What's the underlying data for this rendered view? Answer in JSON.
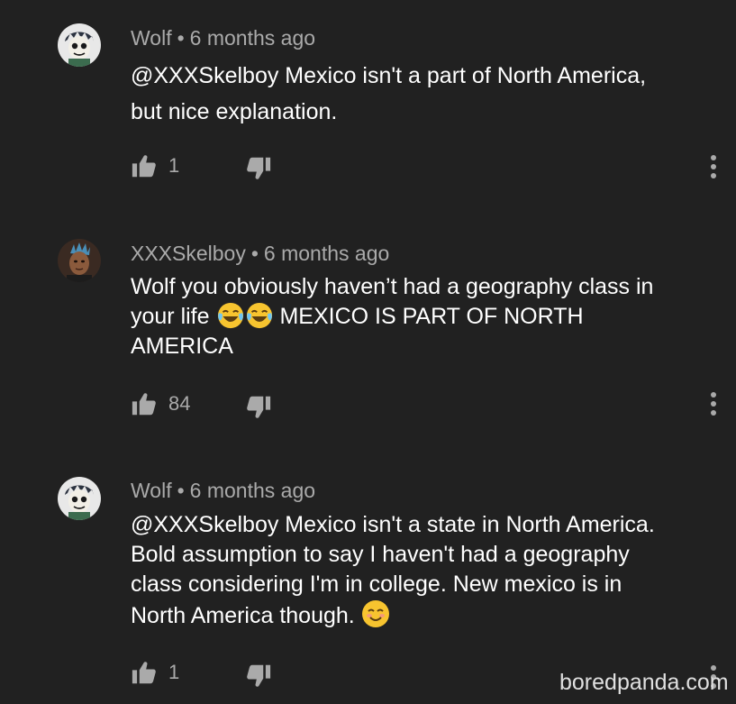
{
  "comments": [
    {
      "author": "Wolf",
      "separator": "•",
      "time": "6 months ago",
      "lines": [
        "@XXXSkelboy Mexico isn't a part of North America,",
        "but nice explanation."
      ],
      "likes": "1",
      "avatar_icon": "cartoon-face-avatar"
    },
    {
      "author": "XXXSkelboy",
      "separator": "•",
      "time": "6 months ago",
      "lines": [
        "Wolf you obviously haven’t had a geography class in",
        "your life",
        "MEXICO IS PART OF NORTH",
        "AMERICA"
      ],
      "emojis": [
        "tears-of-joy-emoji",
        "tears-of-joy-emoji"
      ],
      "likes": "84",
      "avatar_icon": "dark-portrait-avatar"
    },
    {
      "author": "Wolf",
      "separator": "•",
      "time": "6 months ago",
      "lines": [
        "@XXXSkelboy Mexico isn't a state in North America.",
        "Bold assumption to say I haven't had a geography",
        "class considering I'm in college. New mexico is in",
        "North America though."
      ],
      "emojis": [
        "smiling-face-emoji"
      ],
      "likes": "1",
      "avatar_icon": "cartoon-face-avatar"
    }
  ],
  "watermark": "boredpanda.com",
  "colors": {
    "background": "#212121",
    "meta_text": "#aaaaaa",
    "body_text": "#ffffff",
    "icon": "#aaaaaa"
  }
}
